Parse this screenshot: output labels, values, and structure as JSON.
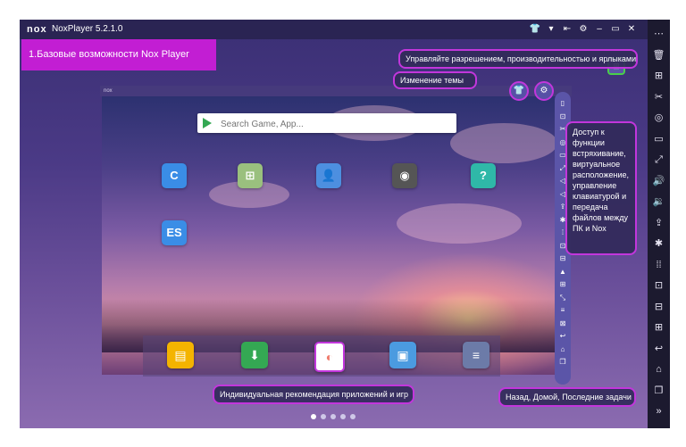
{
  "titlebar": {
    "logo": "nox",
    "title": "NoxPlayer 5.2.1.0",
    "buttons": [
      "👕",
      "▾",
      "⇤",
      "⚙",
      "–",
      "▭",
      "✕"
    ]
  },
  "banner": {
    "text": "1.Базовые возможности Nox Player"
  },
  "screen": {
    "top_label": "nox"
  },
  "search": {
    "placeholder": "Search Game, App..."
  },
  "callouts": {
    "permissions": "Управляйте разрешением, производительностью и ярлыками",
    "theme": "Изменение темы",
    "access": "Доступ к функции встряхивание, виртуальное расположение, управление клавиатурой и передача файлов между ПК и Nox",
    "recommend": "Индивидуальная рекомендация приложений и игр",
    "nav": "Назад, Домой, Последние задачи"
  },
  "theme_buttons": {
    "shirt": "👕",
    "gear": "⚙"
  },
  "apps": [
    {
      "name": "C",
      "color": "#3a8de6"
    },
    {
      "name": "⊞",
      "color": "#9ac07e"
    },
    {
      "name": "👤",
      "color": "#4d8fe0"
    },
    {
      "name": "◉",
      "color": "#555555"
    },
    {
      "name": "?",
      "color": "#2fb8a8"
    },
    {
      "name": "ES",
      "color": "#3a8de6"
    }
  ],
  "dock_apps": [
    {
      "name": "▤",
      "color": "#f4b400"
    },
    {
      "name": "⬇",
      "color": "#34a853"
    },
    {
      "name": "◐",
      "color": "#ef7a6b"
    },
    {
      "name": "▣",
      "color": "#4b9be0"
    },
    {
      "name": "≡",
      "color": "#6c7ba8"
    }
  ],
  "sidebar": [
    "⋯",
    "🗑",
    "⊞",
    "✂",
    "◎",
    "▭",
    "⤢",
    "🔊",
    "🔉",
    "⇪",
    "✱",
    "⁞⁞",
    "⊡",
    "⊟",
    "⊞",
    "↩",
    "⌂",
    "❐",
    "»"
  ],
  "emu_toolbar": [
    "▯",
    "⊡",
    "✂",
    "◎",
    "▭",
    "⤢",
    "◁",
    "◁",
    "⇪",
    "✱",
    "⁞",
    "⊡",
    "⊟",
    "▲",
    "⊞",
    "⤡",
    "≡",
    "⊠",
    "↩",
    "⌂",
    "❐"
  ],
  "colors": {
    "accent": "#c236dc",
    "banner": "#c21ed3",
    "titlebar": "#2a2453",
    "sidebar": "#1c1a2f"
  }
}
